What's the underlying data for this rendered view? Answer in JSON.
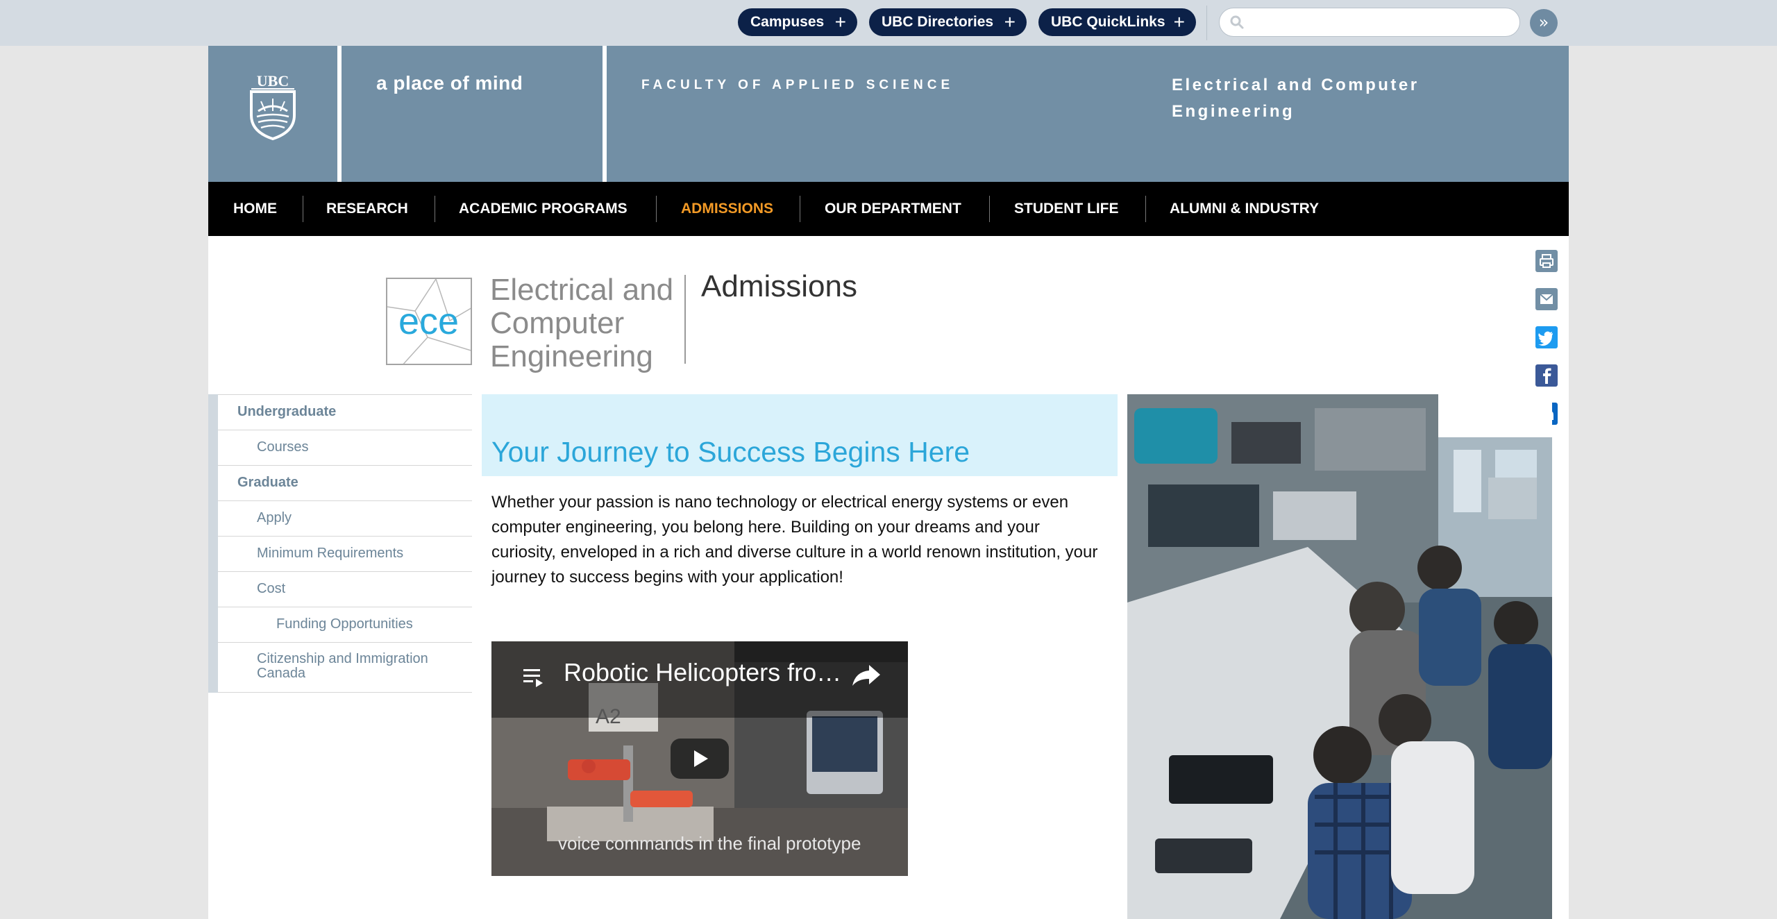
{
  "topbar": {
    "campuses": "Campuses",
    "directories": "UBC Directories",
    "quicklinks": "UBC QuickLinks",
    "plus": "+",
    "search_placeholder": "",
    "go": "»"
  },
  "header": {
    "crest_text": "UBC",
    "tagline": "a place of mind",
    "faculty": "FACULTY OF APPLIED SCIENCE",
    "department": "Electrical and Computer Engineering"
  },
  "nav": {
    "items": [
      "HOME",
      "RESEARCH",
      "ACADEMIC PROGRAMS",
      "ADMISSIONS",
      "OUR DEPARTMENT",
      "STUDENT LIFE",
      "ALUMNI & INDUSTRY"
    ]
  },
  "logo": {
    "mark": "ece",
    "line1": "Electrical and",
    "line2": "Computer",
    "line3": "Engineering",
    "section": "Admissions"
  },
  "sidebar": {
    "items": [
      "Undergraduate",
      "Courses",
      "Graduate",
      "Apply",
      "Minimum Requirements",
      "Cost",
      "Funding Opportunities",
      "Citizenship and Immigration Canada"
    ]
  },
  "main": {
    "heading": "Your Journey to Success Begins Here",
    "paragraph": "Whether your passion is nano technology or electrical energy systems or even computer engineering, you belong here. Building on your dreams and your curiosity, enveloped in a rich and diverse culture in a world renown institution, your journey to success begins with your application!"
  },
  "video": {
    "title": "Robotic Helicopters fro…",
    "sign": "A2",
    "caption": "voice commands in the  final prototype"
  },
  "colors": {
    "ubc_navy": "#0c2148",
    "header_blue": "#728fa5",
    "active_nav": "#f39a26",
    "heading_blue": "#2ba6d9",
    "hero_bg": "#d9f2fb"
  },
  "icons": {
    "social": [
      "print-icon",
      "email-icon",
      "twitter-icon",
      "facebook-icon",
      "linkedin-icon"
    ]
  }
}
